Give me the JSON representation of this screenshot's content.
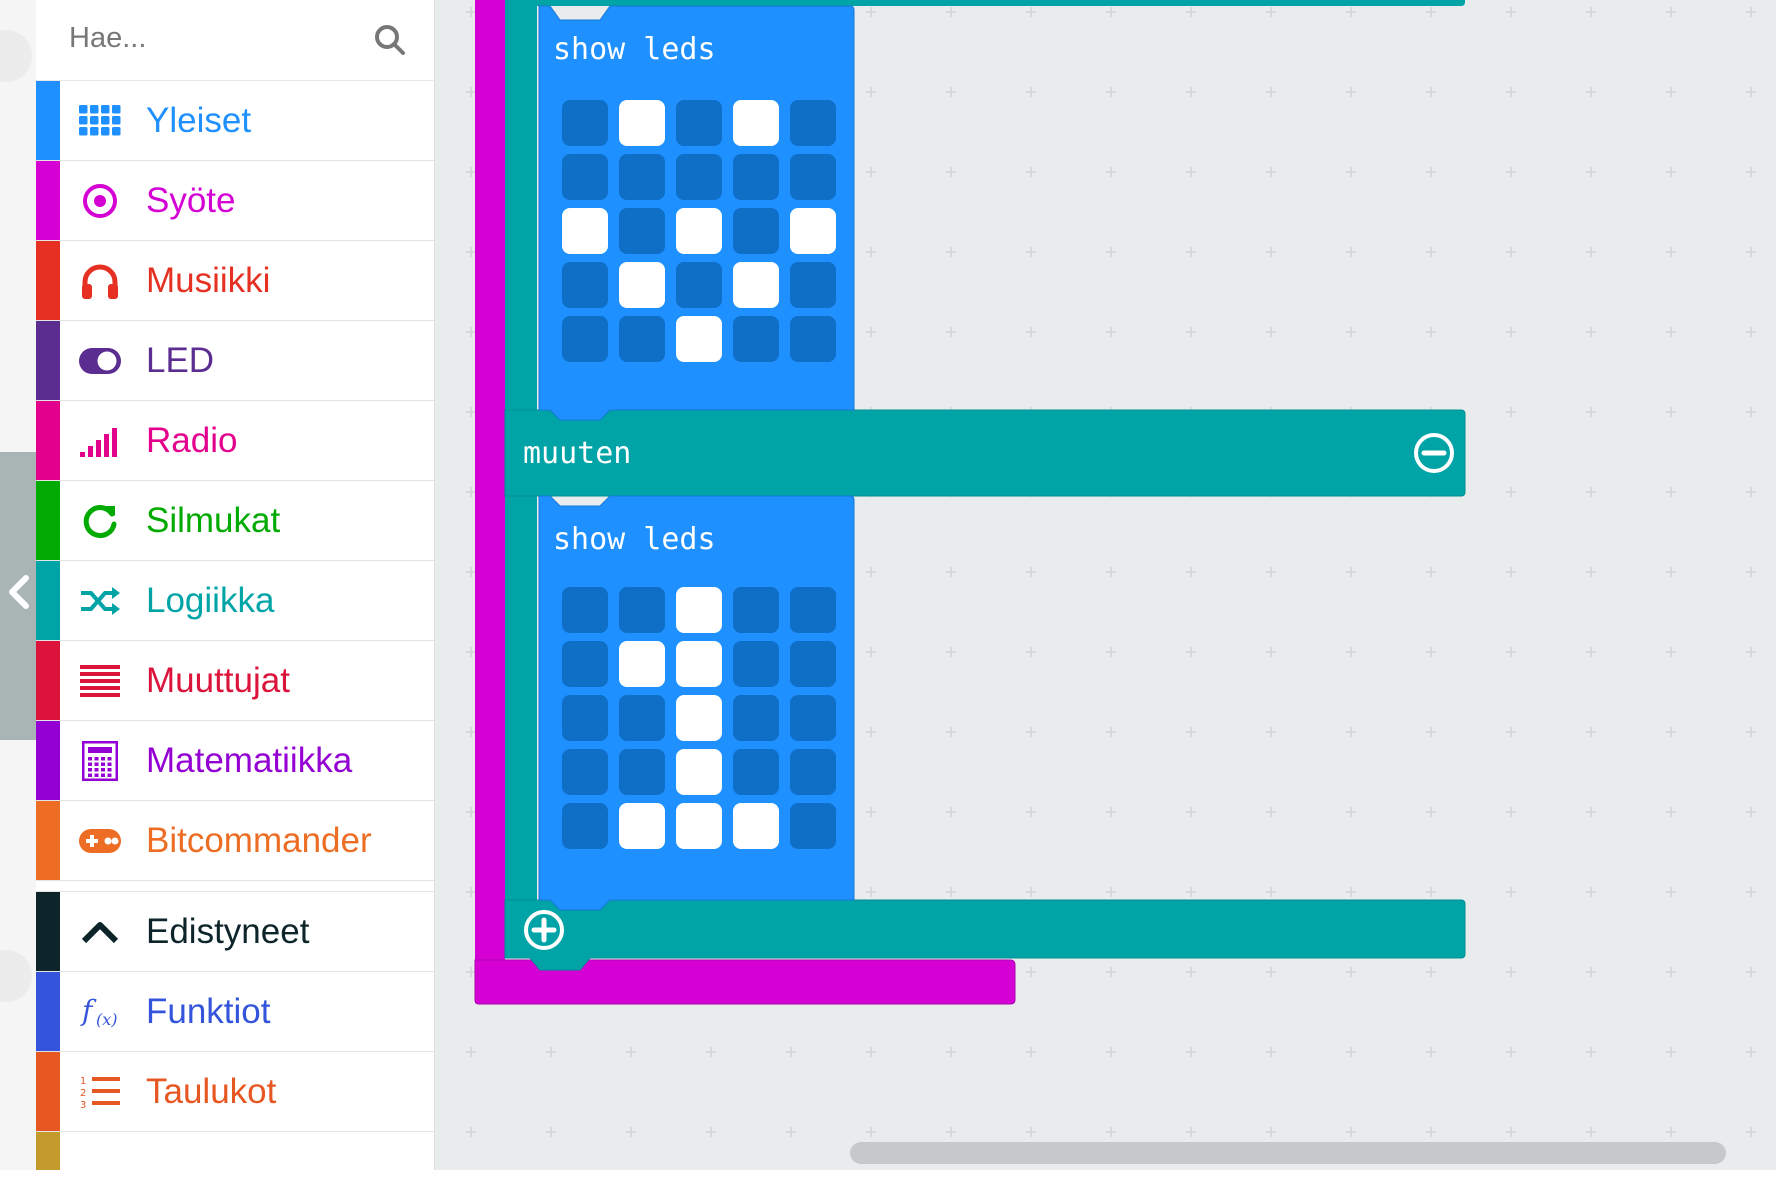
{
  "search": {
    "placeholder": "Hae..."
  },
  "categories": [
    {
      "label": "Yleiset",
      "color": "#1e90ff",
      "icon": "grid-icon"
    },
    {
      "label": "Syöte",
      "color": "#d400d4",
      "icon": "target-icon"
    },
    {
      "label": "Musiikki",
      "color": "#e63022",
      "icon": "headphones-icon"
    },
    {
      "label": "LED",
      "color": "#5c2d91",
      "icon": "toggle-icon"
    },
    {
      "label": "Radio",
      "color": "#e3008c",
      "icon": "signal-bars-icon"
    },
    {
      "label": "Silmukat",
      "color": "#00aa00",
      "icon": "refresh-icon"
    },
    {
      "label": "Logiikka",
      "color": "#00a4a6",
      "icon": "shuffle-icon"
    },
    {
      "label": "Muuttujat",
      "color": "#dc143c",
      "icon": "lines-icon"
    },
    {
      "label": "Matematiikka",
      "color": "#9400d3",
      "icon": "calculator-icon"
    },
    {
      "label": "Bitcommander",
      "color": "#ec6d23",
      "icon": "gamepad-icon"
    }
  ],
  "advanced_categories": [
    {
      "label": "Edistyneet",
      "color": "#0d252a",
      "icon": "chevron-up-icon"
    },
    {
      "label": "Funktiot",
      "color": "#3455db",
      "icon": "function-icon"
    },
    {
      "label": "Taulukot",
      "color": "#e65722",
      "icon": "numbered-list-icon"
    }
  ],
  "blocks": {
    "show_leds_label_1": "show leds",
    "else_label": "muuten",
    "show_leds_label_2": "show leds",
    "leds_1": [
      [
        0,
        1,
        0,
        1,
        0
      ],
      [
        0,
        0,
        0,
        0,
        0
      ],
      [
        1,
        0,
        1,
        0,
        1
      ],
      [
        0,
        1,
        0,
        1,
        0
      ],
      [
        0,
        0,
        1,
        0,
        0
      ]
    ],
    "leds_2": [
      [
        0,
        0,
        1,
        0,
        0
      ],
      [
        0,
        1,
        1,
        0,
        0
      ],
      [
        0,
        0,
        1,
        0,
        0
      ],
      [
        0,
        0,
        1,
        0,
        0
      ],
      [
        0,
        1,
        1,
        1,
        0
      ]
    ]
  },
  "colors": {
    "logic": "#00a4a6",
    "input": "#d400d4",
    "basic": "#1e90ff",
    "led_off": "#0f6fc6",
    "led_on": "#ffffff"
  }
}
